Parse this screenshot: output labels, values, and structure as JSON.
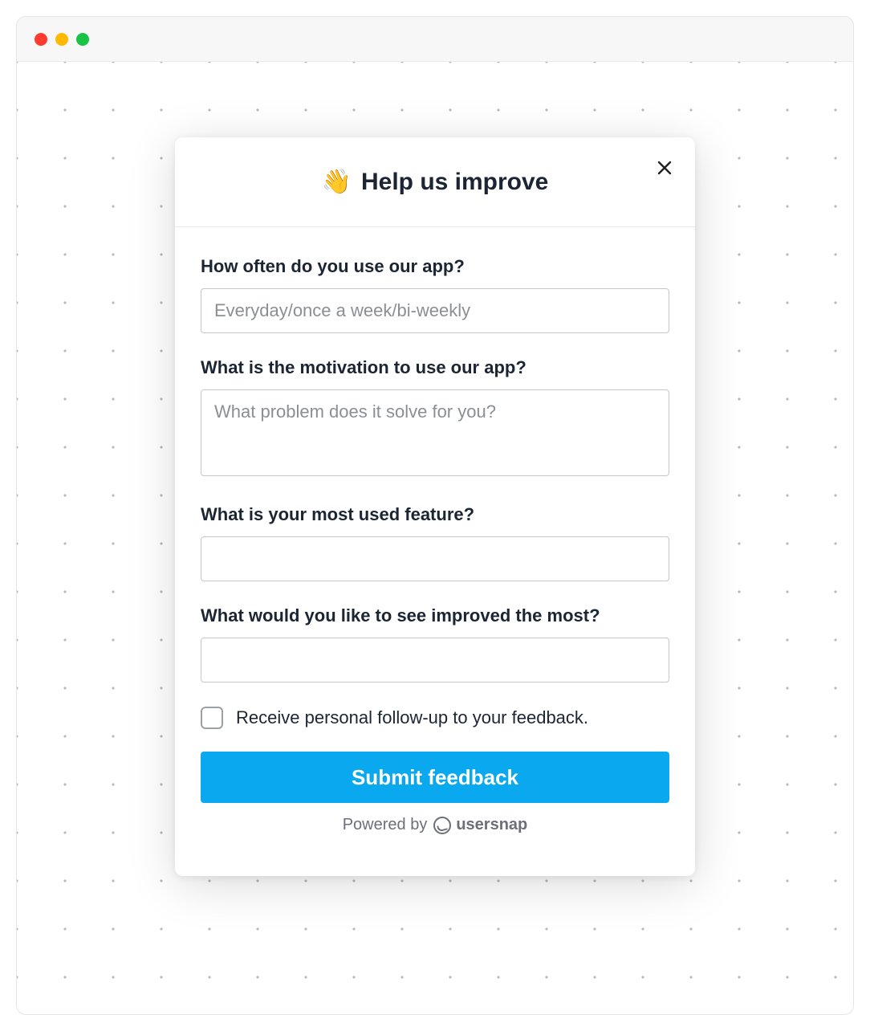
{
  "modal": {
    "title_emoji": "👋",
    "title": "Help us improve",
    "questions": [
      {
        "label": "How often do you use our app?",
        "placeholder": "Everyday/once a week/bi-weekly",
        "type": "input",
        "value": ""
      },
      {
        "label": "What is the motivation to use our app?",
        "placeholder": "What problem does it solve for you?",
        "type": "textarea",
        "value": ""
      },
      {
        "label": "What is your most used feature?",
        "placeholder": "",
        "type": "input",
        "value": ""
      },
      {
        "label": "What would you like to see improved the most?",
        "placeholder": "",
        "type": "input",
        "value": ""
      }
    ],
    "followup_checkbox": {
      "label": "Receive personal follow-up to your feedback.",
      "checked": false
    },
    "submit_label": "Submit feedback",
    "footer_prefix": "Powered by",
    "footer_brand": "usersnap"
  }
}
